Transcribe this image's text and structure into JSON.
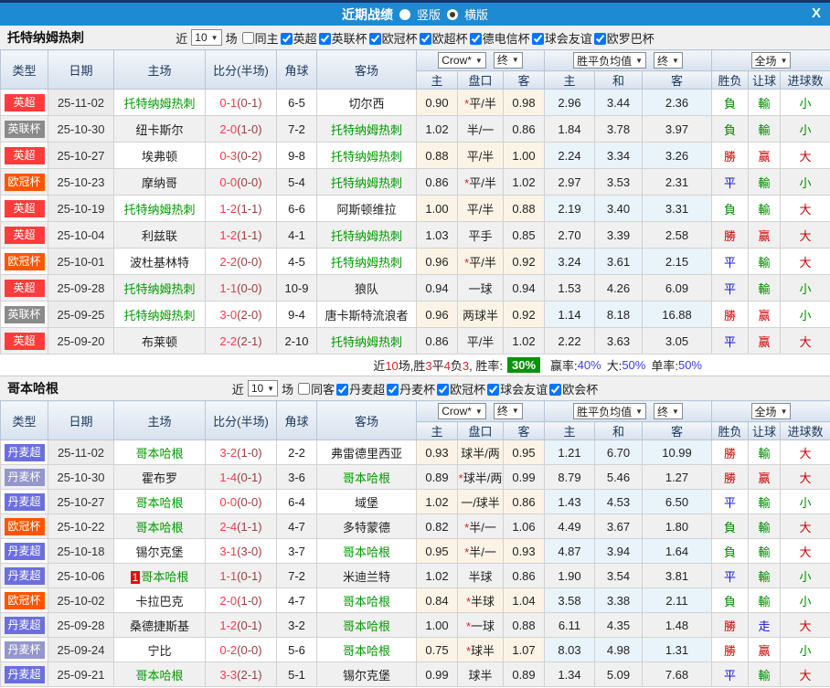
{
  "titlebar": {
    "title": "近期战绩",
    "vertical_label": "竖版",
    "horizontal_label": "横版",
    "selected_mode": "横版",
    "close_label": "X"
  },
  "colors": {
    "titlebar_blue": "#1d8ad2",
    "type_badges": {
      "英超": "#ff3b3b",
      "英联杯": "#8a8a8a",
      "欧冠杯": "#ff5400",
      "丹麦超": "#6b6fde",
      "丹麦杯": "#9496cc"
    },
    "results": {
      "勝": "#cc0000",
      "赢": "#cc0000",
      "大": "#cc0000",
      "負": "#008800",
      "輸": "#008800",
      "小": "#008800",
      "平": "#1414dd",
      "走": "#1414dd"
    },
    "team_highlight": "#009900",
    "score_fulltime": "#f93b50",
    "score_halftime": "#a03c3c",
    "rate_box_green": "#089308",
    "percent_blue": "#3b3bf0"
  },
  "table_header": {
    "type": "类型",
    "date": "日期",
    "home": "主场",
    "score": "比分(半场)",
    "corner": "角球",
    "away": "客场",
    "crow_select": "Crow*",
    "final_select": "终",
    "odds_home": "主",
    "odds_handicap": "盘口",
    "odds_away": "客",
    "mean_select": "胜平负均值",
    "mean_home": "主",
    "mean_draw": "和",
    "mean_away": "客",
    "scope_select": "全场",
    "res_wdl": "胜负",
    "res_handicap": "让球",
    "res_goals": "进球数"
  },
  "sections": [
    {
      "team": "托特纳姆热刺",
      "near_label": "近",
      "match_count": "10",
      "games_label": "场",
      "same_label": "同主",
      "same_checked": false,
      "leagues": [
        "英超",
        "英联杯",
        "欧冠杯",
        "欧超杯",
        "德电信杯",
        "球会友谊",
        "欧罗巴杯"
      ],
      "rows": [
        {
          "t": "英超",
          "d": "25-11-02",
          "h": "托特纳姆热刺",
          "hh": true,
          "s": "0-1",
          "sh": "(0-1)",
          "c": "6-5",
          "a": "切尔西",
          "ah": false,
          "o": [
            "0.90",
            "*平/半",
            "0.98"
          ],
          "m": [
            "2.96",
            "3.44",
            "2.36"
          ],
          "r": [
            "負",
            "輸",
            "小"
          ]
        },
        {
          "t": "英联杯",
          "d": "25-10-30",
          "h": "纽卡斯尔",
          "hh": false,
          "s": "2-0",
          "sh": "(1-0)",
          "c": "7-2",
          "a": "托特纳姆热刺",
          "ah": true,
          "o": [
            "1.02",
            "半/一",
            "0.86"
          ],
          "m": [
            "1.84",
            "3.78",
            "3.97"
          ],
          "r": [
            "負",
            "輸",
            "小"
          ]
        },
        {
          "t": "英超",
          "d": "25-10-27",
          "h": "埃弗顿",
          "hh": false,
          "s": "0-3",
          "sh": "(0-2)",
          "c": "9-8",
          "a": "托特纳姆热刺",
          "ah": true,
          "o": [
            "0.88",
            "平/半",
            "1.00"
          ],
          "m": [
            "2.24",
            "3.34",
            "3.26"
          ],
          "r": [
            "勝",
            "赢",
            "大"
          ]
        },
        {
          "t": "欧冠杯",
          "d": "25-10-23",
          "h": "摩纳哥",
          "hh": false,
          "s": "0-0",
          "sh": "(0-0)",
          "c": "5-4",
          "a": "托特纳姆热刺",
          "ah": true,
          "o": [
            "0.86",
            "*平/半",
            "1.02"
          ],
          "m": [
            "2.97",
            "3.53",
            "2.31"
          ],
          "r": [
            "平",
            "輸",
            "小"
          ]
        },
        {
          "t": "英超",
          "d": "25-10-19",
          "h": "托特纳姆热刺",
          "hh": true,
          "s": "1-2",
          "sh": "(1-1)",
          "c": "6-6",
          "a": "阿斯顿维拉",
          "ah": false,
          "o": [
            "1.00",
            "平/半",
            "0.88"
          ],
          "m": [
            "2.19",
            "3.40",
            "3.31"
          ],
          "r": [
            "負",
            "輸",
            "大"
          ]
        },
        {
          "t": "英超",
          "d": "25-10-04",
          "h": "利兹联",
          "hh": false,
          "s": "1-2",
          "sh": "(1-1)",
          "c": "4-1",
          "a": "托特纳姆热刺",
          "ah": true,
          "o": [
            "1.03",
            "平手",
            "0.85"
          ],
          "m": [
            "2.70",
            "3.39",
            "2.58"
          ],
          "r": [
            "勝",
            "赢",
            "大"
          ]
        },
        {
          "t": "欧冠杯",
          "d": "25-10-01",
          "h": "波杜基林特",
          "hh": false,
          "s": "2-2",
          "sh": "(0-0)",
          "c": "4-5",
          "a": "托特纳姆热刺",
          "ah": true,
          "o": [
            "0.96",
            "*平/半",
            "0.92"
          ],
          "m": [
            "3.24",
            "3.61",
            "2.15"
          ],
          "r": [
            "平",
            "輸",
            "大"
          ]
        },
        {
          "t": "英超",
          "d": "25-09-28",
          "h": "托特纳姆热刺",
          "hh": true,
          "s": "1-1",
          "sh": "(0-0)",
          "c": "10-9",
          "a": "狼队",
          "ah": false,
          "o": [
            "0.94",
            "一球",
            "0.94"
          ],
          "m": [
            "1.53",
            "4.26",
            "6.09"
          ],
          "r": [
            "平",
            "輸",
            "小"
          ]
        },
        {
          "t": "英联杯",
          "d": "25-09-25",
          "h": "托特纳姆热刺",
          "hh": true,
          "s": "3-0",
          "sh": "(2-0)",
          "c": "9-4",
          "a": "唐卡斯特流浪者",
          "ah": false,
          "o": [
            "0.96",
            "两球半",
            "0.92"
          ],
          "m": [
            "1.14",
            "8.18",
            "16.88"
          ],
          "r": [
            "勝",
            "赢",
            "小"
          ]
        },
        {
          "t": "英超",
          "d": "25-09-20",
          "h": "布莱顿",
          "hh": false,
          "s": "2-2",
          "sh": "(2-1)",
          "c": "2-10",
          "a": "托特纳姆热刺",
          "ah": true,
          "o": [
            "0.86",
            "平/半",
            "1.02"
          ],
          "m": [
            "2.22",
            "3.63",
            "3.05"
          ],
          "r": [
            "平",
            "赢",
            "大"
          ]
        }
      ],
      "summary": {
        "record_text": "近10场,胜3平4负3, 胜率:",
        "win_rate": "30%",
        "odds_win_label": "赢率:",
        "odds_win": "40%",
        "big_label": "大:",
        "big": "50%",
        "single_label": "单率:",
        "single": "50%"
      }
    },
    {
      "team": "哥本哈根",
      "near_label": "近",
      "match_count": "10",
      "games_label": "场",
      "same_label": "同客",
      "same_checked": false,
      "leagues": [
        "丹麦超",
        "丹麦杯",
        "欧冠杯",
        "球会友谊",
        "欧会杯"
      ],
      "rows": [
        {
          "t": "丹麦超",
          "d": "25-11-02",
          "h": "哥本哈根",
          "hh": true,
          "s": "3-2",
          "sh": "(1-0)",
          "c": "2-2",
          "a": "弗雷德里西亚",
          "ah": false,
          "o": [
            "0.93",
            "球半/两",
            "0.95"
          ],
          "m": [
            "1.21",
            "6.70",
            "10.99"
          ],
          "r": [
            "勝",
            "輸",
            "大"
          ]
        },
        {
          "t": "丹麦杯",
          "d": "25-10-30",
          "h": "霍布罗",
          "hh": false,
          "s": "1-4",
          "sh": "(0-1)",
          "c": "3-6",
          "a": "哥本哈根",
          "ah": true,
          "o": [
            "0.89",
            "*球半/两",
            "0.99"
          ],
          "m": [
            "8.79",
            "5.46",
            "1.27"
          ],
          "r": [
            "勝",
            "赢",
            "大"
          ]
        },
        {
          "t": "丹麦超",
          "d": "25-10-27",
          "h": "哥本哈根",
          "hh": true,
          "s": "0-0",
          "sh": "(0-0)",
          "c": "6-4",
          "a": "域堡",
          "ah": false,
          "o": [
            "1.02",
            "一/球半",
            "0.86"
          ],
          "m": [
            "1.43",
            "4.53",
            "6.50"
          ],
          "r": [
            "平",
            "輸",
            "小"
          ]
        },
        {
          "t": "欧冠杯",
          "d": "25-10-22",
          "h": "哥本哈根",
          "hh": true,
          "s": "2-4",
          "sh": "(1-1)",
          "c": "4-7",
          "a": "多特蒙德",
          "ah": false,
          "o": [
            "0.82",
            "*半/一",
            "1.06"
          ],
          "m": [
            "4.49",
            "3.67",
            "1.80"
          ],
          "r": [
            "負",
            "輸",
            "大"
          ]
        },
        {
          "t": "丹麦超",
          "d": "25-10-18",
          "h": "锡尔克堡",
          "hh": false,
          "s": "3-1",
          "sh": "(3-0)",
          "c": "3-7",
          "a": "哥本哈根",
          "ah": true,
          "o": [
            "0.95",
            "*半/一",
            "0.93"
          ],
          "m": [
            "4.87",
            "3.94",
            "1.64"
          ],
          "r": [
            "負",
            "輸",
            "大"
          ]
        },
        {
          "t": "丹麦超",
          "d": "25-10-06",
          "h": "哥本哈根",
          "hh": true,
          "hb": "1",
          "s": "1-1",
          "sh": "(0-1)",
          "c": "7-2",
          "a": "米迪兰特",
          "ah": false,
          "o": [
            "1.02",
            "半球",
            "0.86"
          ],
          "m": [
            "1.90",
            "3.54",
            "3.81"
          ],
          "r": [
            "平",
            "輸",
            "小"
          ]
        },
        {
          "t": "欧冠杯",
          "d": "25-10-02",
          "h": "卡拉巴克",
          "hh": false,
          "s": "2-0",
          "sh": "(1-0)",
          "c": "4-7",
          "a": "哥本哈根",
          "ah": true,
          "o": [
            "0.84",
            "*半球",
            "1.04"
          ],
          "m": [
            "3.58",
            "3.38",
            "2.11"
          ],
          "r": [
            "負",
            "輸",
            "小"
          ]
        },
        {
          "t": "丹麦超",
          "d": "25-09-28",
          "h": "桑德捷斯基",
          "hh": false,
          "s": "1-2",
          "sh": "(0-1)",
          "c": "3-2",
          "a": "哥本哈根",
          "ah": true,
          "o": [
            "1.00",
            "*一球",
            "0.88"
          ],
          "m": [
            "6.11",
            "4.35",
            "1.48"
          ],
          "r": [
            "勝",
            "走",
            "大"
          ]
        },
        {
          "t": "丹麦杯",
          "d": "25-09-24",
          "h": "宁比",
          "hh": false,
          "s": "0-2",
          "sh": "(0-0)",
          "c": "5-6",
          "a": "哥本哈根",
          "ah": true,
          "o": [
            "0.75",
            "*球半",
            "1.07"
          ],
          "m": [
            "8.03",
            "4.98",
            "1.31"
          ],
          "r": [
            "勝",
            "赢",
            "小"
          ]
        },
        {
          "t": "丹麦超",
          "d": "25-09-21",
          "h": "哥本哈根",
          "hh": true,
          "s": "3-3",
          "sh": "(2-1)",
          "c": "5-1",
          "a": "锡尔克堡",
          "ah": false,
          "o": [
            "0.99",
            "球半",
            "0.89"
          ],
          "m": [
            "1.34",
            "5.09",
            "7.68"
          ],
          "r": [
            "平",
            "輸",
            "大"
          ]
        }
      ],
      "summary": null
    }
  ]
}
